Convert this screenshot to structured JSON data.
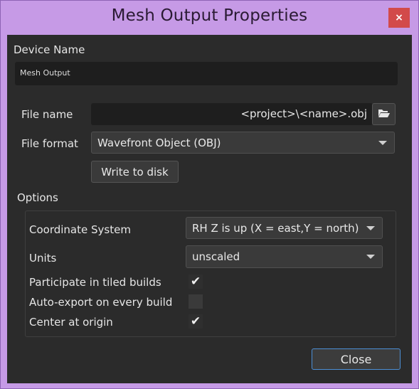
{
  "window": {
    "title": "Mesh Output Properties",
    "close_glyph": "×"
  },
  "device": {
    "label": "Device Name",
    "value": "Mesh Output"
  },
  "file": {
    "name_label": "File name",
    "name_value": "<project>\\<name>.obj",
    "browse_icon": "folder-open-icon",
    "format_label": "File format",
    "format_value": "Wavefront Object (OBJ)",
    "write_button": "Write to disk"
  },
  "options": {
    "title": "Options",
    "coordinate_label": "Coordinate System",
    "coordinate_value": "RH Z is up (X = east,Y = north)",
    "units_label": "Units",
    "units_value": "unscaled",
    "tiled_label": "Participate in tiled builds",
    "tiled_checked": "✔",
    "autoexport_label": "Auto-export on every build",
    "autoexport_checked": "",
    "center_label": "Center at origin",
    "center_checked": "✔"
  },
  "footer": {
    "close_button": "Close"
  },
  "colors": {
    "frame": "#c69ae6",
    "panel": "#2b2b2b",
    "accent_border": "#4c8fd6",
    "close_red": "#d24a4a"
  }
}
